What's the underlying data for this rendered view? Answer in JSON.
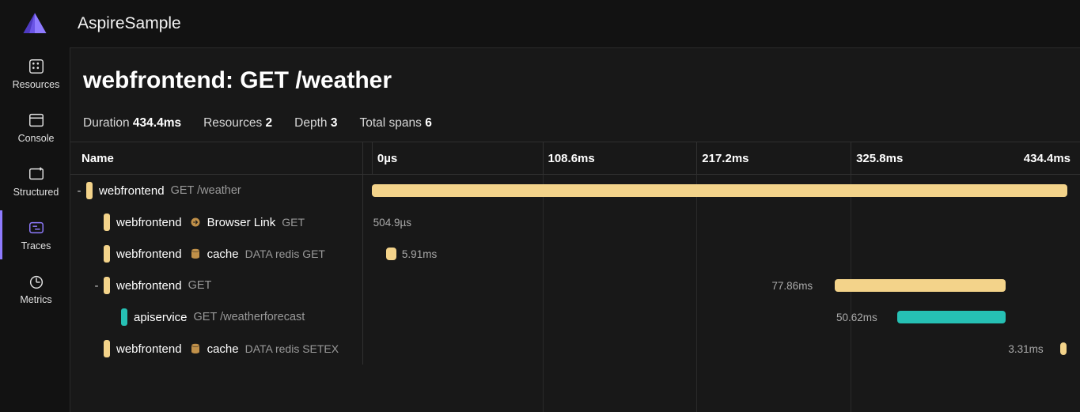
{
  "app_title": "AspireSample",
  "colors": {
    "accent": "#8f7bff",
    "bar_yellow": "#f3d38a",
    "bar_teal": "#26c0b4",
    "badge_brown": "#c09049"
  },
  "sidebar": {
    "items": [
      {
        "label": "Resources",
        "icon": "resources-icon",
        "active": false
      },
      {
        "label": "Console",
        "icon": "console-icon",
        "active": false
      },
      {
        "label": "Structured",
        "icon": "structured-icon",
        "active": false
      },
      {
        "label": "Traces",
        "icon": "traces-icon",
        "active": true
      },
      {
        "label": "Metrics",
        "icon": "metrics-icon",
        "active": false
      }
    ]
  },
  "page_title": "webfrontend: GET /weather",
  "summary": {
    "duration_label": "Duration",
    "duration_value": "434.4ms",
    "resources_label": "Resources",
    "resources_value": "2",
    "depth_label": "Depth",
    "depth_value": "3",
    "spans_label": "Total spans",
    "spans_value": "6"
  },
  "table": {
    "name_header": "Name",
    "ticks": [
      "0µs",
      "108.6ms",
      "217.2ms",
      "325.8ms",
      "434.4ms"
    ]
  },
  "spans": [
    {
      "indent": 0,
      "collapsible": true,
      "pill_color": "#f3d38a",
      "service": "webfrontend",
      "detail": "GET /weather",
      "badges": [],
      "bar": {
        "start_pct": 1.2,
        "width_pct": 97.0,
        "color": "#f3d38a"
      },
      "label": null
    },
    {
      "indent": 1,
      "collapsible": false,
      "pill_color": "#f3d38a",
      "service": "webfrontend",
      "badges": [
        {
          "type": "arrow",
          "text": "Browser Link"
        }
      ],
      "sub": "GET",
      "bar": null,
      "label": {
        "text": "504.9µs",
        "left_pct": 1.4
      }
    },
    {
      "indent": 1,
      "collapsible": false,
      "pill_color": "#f3d38a",
      "service": "webfrontend",
      "badges": [
        {
          "type": "db",
          "text": "cache"
        }
      ],
      "sub": "DATA redis GET",
      "bar": {
        "start_pct": 3.2,
        "width_pct": 1.4,
        "color": "#f3d38a"
      },
      "label": {
        "text": "5.91ms",
        "left_pct": 5.4
      }
    },
    {
      "indent": 1,
      "collapsible": true,
      "pill_color": "#f3d38a",
      "service": "webfrontend",
      "detail": "GET",
      "badges": [],
      "bar": {
        "start_pct": 65.8,
        "width_pct": 23.8,
        "color": "#f3d38a"
      },
      "label": {
        "text": "77.86ms",
        "left_pct": 57.0
      }
    },
    {
      "indent": 2,
      "collapsible": false,
      "pill_color": "#26c0b4",
      "service": "apiservice",
      "detail": "GET /weatherforecast",
      "badges": [],
      "bar": {
        "start_pct": 74.5,
        "width_pct": 15.1,
        "color": "#26c0b4"
      },
      "label": {
        "text": "50.62ms",
        "left_pct": 66.0
      }
    },
    {
      "indent": 1,
      "collapsible": false,
      "pill_color": "#f3d38a",
      "service": "webfrontend",
      "badges": [
        {
          "type": "db",
          "text": "cache"
        }
      ],
      "sub": "DATA redis SETEX",
      "bar": {
        "start_pct": 97.2,
        "width_pct": 0.9,
        "color": "#f3d38a"
      },
      "label": {
        "text": "3.31ms",
        "left_pct": 90.0
      }
    }
  ]
}
